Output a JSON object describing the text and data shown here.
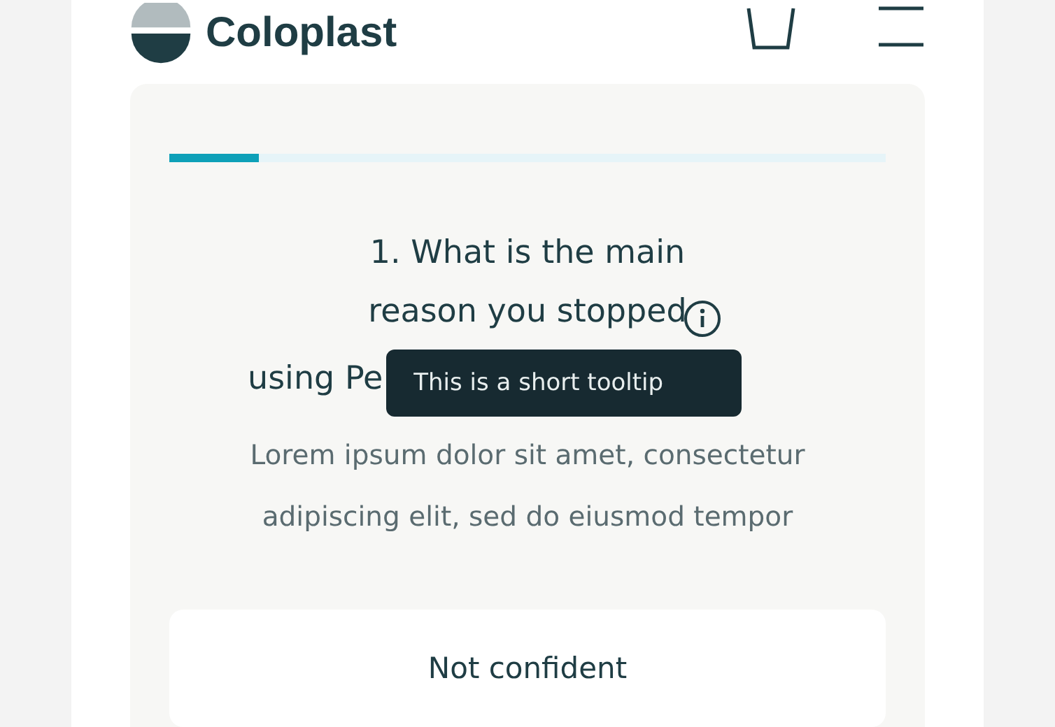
{
  "header": {
    "logo_text": "Coloplast"
  },
  "survey": {
    "progress": {
      "level": 0.125
    },
    "question_lines": [
      "1. What is the main",
      "reason you stopped",
      "using Pe"
    ],
    "tooltip": "This is a short tooltip",
    "description": "Lorem ipsum dolor sit amet, consectetur adipiscing elit, sed do eiusmod tempor",
    "options": [
      {
        "label": "Not confident"
      }
    ]
  }
}
